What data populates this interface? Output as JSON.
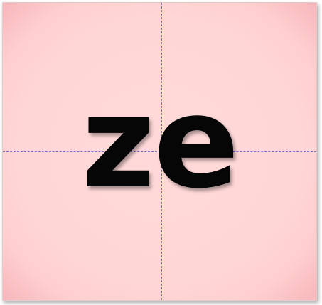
{
  "card": {
    "syllable": "ze",
    "background_color": "#ffd6d6",
    "edge_color": "#f7b6bb",
    "guide_color": "#6f73c4",
    "text_color": "#060606"
  }
}
